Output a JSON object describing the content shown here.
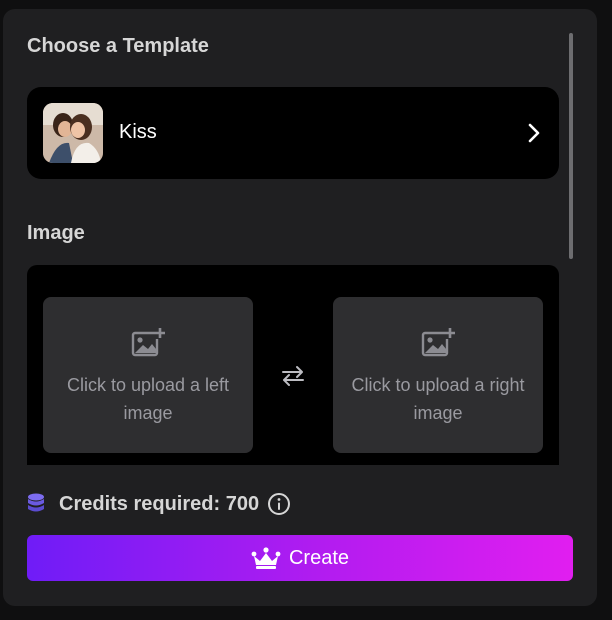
{
  "template_section": {
    "title": "Choose a Template",
    "selected_name": "Kiss",
    "thumbnail_icon": "template-thumbnail",
    "chevron_icon": "chevron-right-icon"
  },
  "image_section": {
    "title": "Image",
    "left_upload_label": "Click to upload a left image",
    "right_upload_label": "Click to upload a right image",
    "upload_icon": "add-photo-icon",
    "swap_icon": "swap-icon"
  },
  "credits": {
    "label": "Credits required: 700",
    "icon": "database-icon",
    "info_icon": "info-icon"
  },
  "create_button": {
    "label": "Create",
    "icon": "crown-icon"
  },
  "colors": {
    "panel_bg": "#1f1f21",
    "card_bg": "#000000",
    "tile_bg": "#2e2e30",
    "accent_start": "#6f1cf7",
    "accent_end": "#e11ef0",
    "credits_icon": "#7c6cf0"
  }
}
